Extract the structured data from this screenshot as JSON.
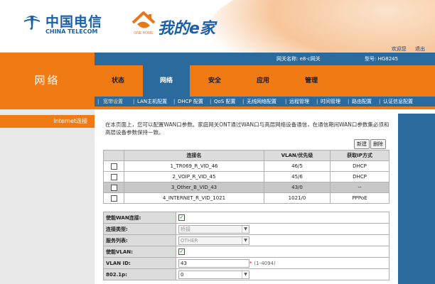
{
  "brand": {
    "cn": "中国电信",
    "en": "CHINA TELECOM",
    "home_title": "我的e家",
    "home_badge": "ONE HOME"
  },
  "top_links": {
    "welcome": "欢迎您",
    "logout": "退出"
  },
  "infobar": {
    "gateway_name": "网关名称: e8-c网关",
    "model": "型号: HG8245"
  },
  "section_title": "网络",
  "tabs": [
    {
      "label": "状态"
    },
    {
      "label": "网络"
    },
    {
      "label": "安全"
    },
    {
      "label": "应用"
    },
    {
      "label": "管理"
    }
  ],
  "subnav": [
    {
      "label": "宽带设置"
    },
    {
      "label": "LAN主机配置"
    },
    {
      "label": "DHCP 配置"
    },
    {
      "label": "QoS 配置"
    },
    {
      "label": "无线网络配置"
    },
    {
      "label": "远程管理"
    },
    {
      "label": "时间管理"
    },
    {
      "label": "路由配置"
    },
    {
      "label": "认证信息配置"
    }
  ],
  "sidebar": {
    "item": "Internet连接"
  },
  "description": "在本页面上，您可以配置WAN口参数。家庭网关ONT通过WAN口与高层网络设备通信，在通信期间WAN口参数集必须和高层设备参数保持一致。",
  "buttons": {
    "new": "新建",
    "delete": "删除"
  },
  "wan_table": {
    "headers": [
      "",
      "连接名",
      "VLAN/优先级",
      "获取IP方式"
    ],
    "rows": [
      {
        "name": "1_TR069_R_VID_46",
        "vlan": "46/5",
        "ip": "DHCP"
      },
      {
        "name": "2_VOIP_R_VID_45",
        "vlan": "45/6",
        "ip": "DHCP"
      },
      {
        "name": "3_Other_B_VID_43",
        "vlan": "43/0",
        "ip": "--"
      },
      {
        "name": "4_INTERNET_R_VID_1021",
        "vlan": "1021/0",
        "ip": "PPPoE"
      }
    ]
  },
  "form": {
    "enable_wan": {
      "label": "使能WAN连接:",
      "checked": "✓"
    },
    "conn_type": {
      "label": "连接类型:",
      "value": "桥接"
    },
    "service_list": {
      "label": "服务列表:",
      "value": "OTHER"
    },
    "enable_vlan": {
      "label": "使能VLAN:",
      "checked": "✓"
    },
    "vlan_id": {
      "label": "VLAN ID:",
      "value": "43",
      "req": "*",
      "hint": "(1-4094)"
    },
    "p8021": {
      "label": "802.1p:",
      "value": "0"
    }
  }
}
